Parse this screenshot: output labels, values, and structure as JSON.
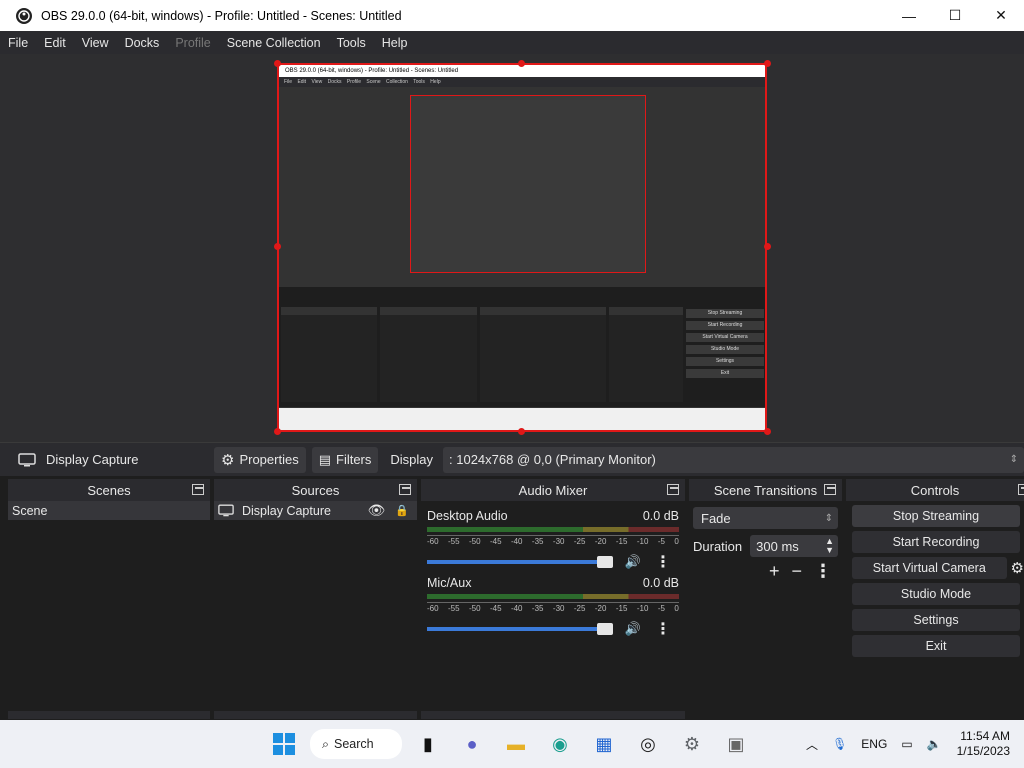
{
  "window": {
    "title": "OBS 29.0.0 (64-bit, windows) - Profile: Untitled - Scenes: Untitled",
    "minimize": "—",
    "maximize": "☐",
    "close": "✕"
  },
  "menu": [
    "File",
    "Edit",
    "View",
    "Docks",
    "Profile",
    "Scene Collection",
    "Tools",
    "Help"
  ],
  "menu_disabled": "Profile",
  "nested_preview": {
    "title": "OBS 29.0.0 (64-bit, windows) - Profile: Untitled - Scenes: Untitled",
    "menu": "File Edit View Docks Profile Scene Collection Tools Help",
    "controls": [
      "Stop Streaming",
      "Start Recording",
      "Start Virtual Camera",
      "Studio Mode",
      "Settings",
      "Exit"
    ]
  },
  "source_toolbar": {
    "source_name": "Display Capture",
    "properties": "Properties",
    "filters": "Filters",
    "display_label": "Display",
    "display_value": ": 1024x768 @ 0,0 (Primary Monitor)"
  },
  "scenes": {
    "header": "Scenes",
    "items": [
      "Scene"
    ]
  },
  "sources": {
    "header": "Sources",
    "items": [
      "Display Capture"
    ]
  },
  "mixer": {
    "header": "Audio Mixer",
    "channels": [
      {
        "name": "Desktop Audio",
        "level": "0.0 dB"
      },
      {
        "name": "Mic/Aux",
        "level": "0.0 dB"
      }
    ],
    "ticks": [
      "-60",
      "-55",
      "-50",
      "-45",
      "-40",
      "-35",
      "-30",
      "-25",
      "-20",
      "-15",
      "-10",
      "-5",
      "0"
    ]
  },
  "transitions": {
    "header": "Scene Transitions",
    "selected": "Fade",
    "duration_label": "Duration",
    "duration_value": "300 ms"
  },
  "controls": {
    "header": "Controls",
    "buttons": [
      "Stop Streaming",
      "Start Recording",
      "Start Virtual Camera",
      "Studio Mode",
      "Settings",
      "Exit"
    ]
  },
  "taskbar": {
    "search": "Search",
    "language": "ENG",
    "time": "11:54 AM",
    "date": "1/15/2023"
  },
  "colors": {
    "accent": "#3b7ad9",
    "selection": "#e01818"
  }
}
